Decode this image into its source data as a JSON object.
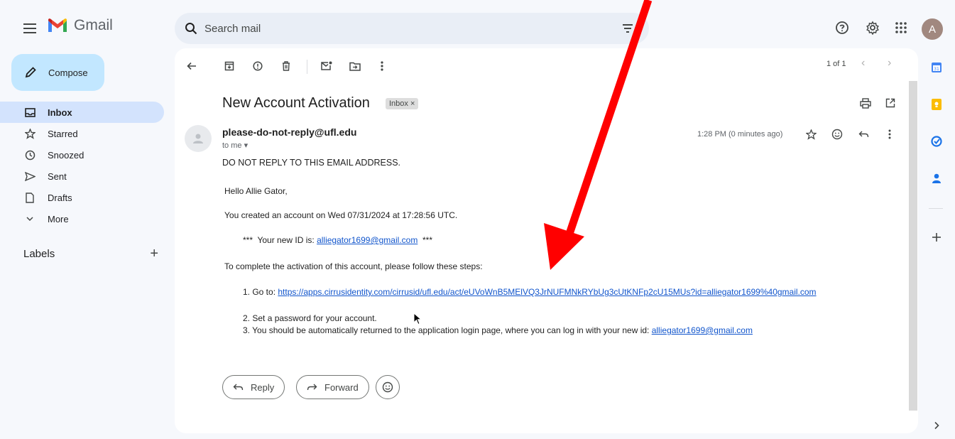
{
  "app": {
    "logo_name": "Gmail",
    "avatar_initial": "A",
    "accent_color": "#c2e7ff",
    "link_color": "#1155cc"
  },
  "search": {
    "placeholder": "Search mail"
  },
  "compose": {
    "label": "Compose"
  },
  "nav": {
    "items": [
      {
        "label": "Inbox",
        "icon": "inbox-icon",
        "active": true
      },
      {
        "label": "Starred",
        "icon": "star-icon"
      },
      {
        "label": "Snoozed",
        "icon": "clock-icon"
      },
      {
        "label": "Sent",
        "icon": "send-icon"
      },
      {
        "label": "Drafts",
        "icon": "draft-icon"
      },
      {
        "label": "More",
        "icon": "chevron-down-icon"
      }
    ],
    "labels_heading": "Labels"
  },
  "toolbar": {
    "pager": "1 of 1"
  },
  "email": {
    "subject": "New Account Activation",
    "inbox_badge": "Inbox ×",
    "sender": "please-do-not-reply@ufl.edu",
    "to": "to me ▾",
    "time": "1:28 PM (0 minutes ago)",
    "body": {
      "line1": "DO NOT REPLY TO THIS EMAIL ADDRESS.",
      "greeting": "Hello Allie Gator,",
      "created": "You created an account on Wed 07/31/2024 at 17:28:56 UTC.",
      "new_id_prefix": "***  Your new ID is: ",
      "new_id": "alliegator1699@gmail.com",
      "new_id_suffix": "  ***",
      "instructions": "To complete the activation of this account, please follow these steps:",
      "step1_prefix": "1. Go to: ",
      "step1_link": "https://apps.cirrusidentity.com/cirrusid/ufl.edu/act/eUVoWnB5MElVQ3JrNUFMNkRYbUg3cUtKNFp2cU15MUs?id=alliegator1699%40gmail.com",
      "step2": "2. Set a password for your account.",
      "step3_prefix": "3. You should be automatically returned to the application login page, where you can log in with your new id: ",
      "step3_link": "alliegator1699@gmail.com"
    },
    "actions": {
      "reply": "Reply",
      "forward": "Forward"
    }
  }
}
